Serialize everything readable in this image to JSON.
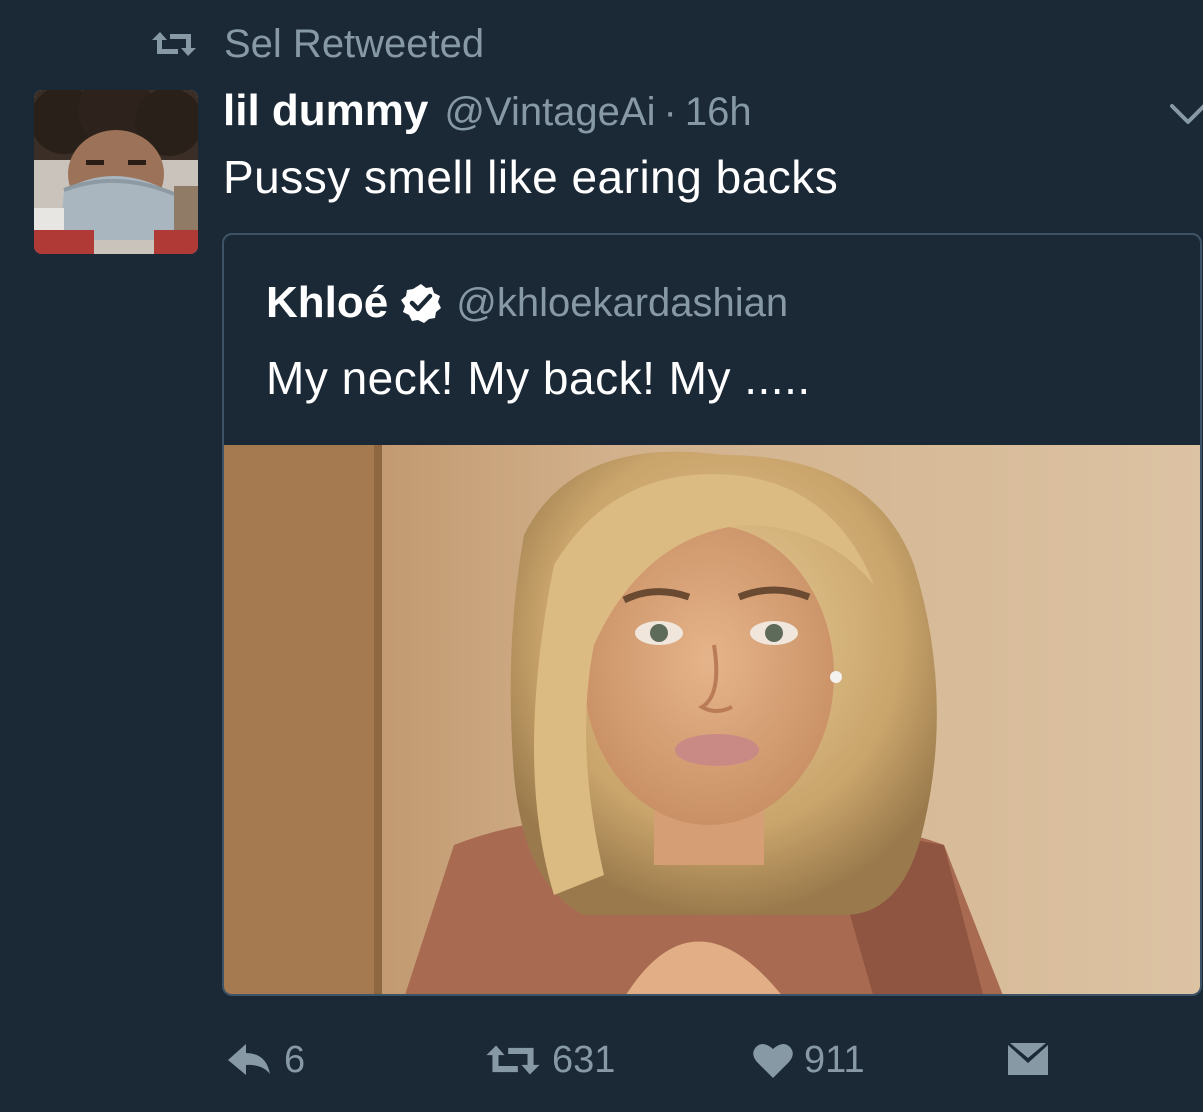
{
  "retweet_context": {
    "icon": "retweet-icon",
    "text": "Sel Retweeted"
  },
  "tweet": {
    "avatar": "avatar-photo",
    "display_name": "lil dummy",
    "handle": "@VintageAi",
    "separator": "·",
    "timestamp": "16h",
    "menu_icon": "chevron-down-icon",
    "text": "Pussy smell like earing backs"
  },
  "quoted_tweet": {
    "display_name": "Khloé",
    "verified_icon": "verified-badge-icon",
    "handle": "@khloekardashian",
    "text": "My neck! My back! My .....",
    "media": "photo"
  },
  "actions": {
    "reply": {
      "icon": "reply-icon",
      "count": "6"
    },
    "retweet": {
      "icon": "retweet-icon",
      "count": "631"
    },
    "like": {
      "icon": "heart-icon",
      "count": "911"
    },
    "dm": {
      "icon": "envelope-icon"
    }
  },
  "colors": {
    "background": "#1b2836",
    "secondary_text": "#8899a6",
    "primary_text": "#ffffff",
    "card_border": "#3d5466"
  }
}
